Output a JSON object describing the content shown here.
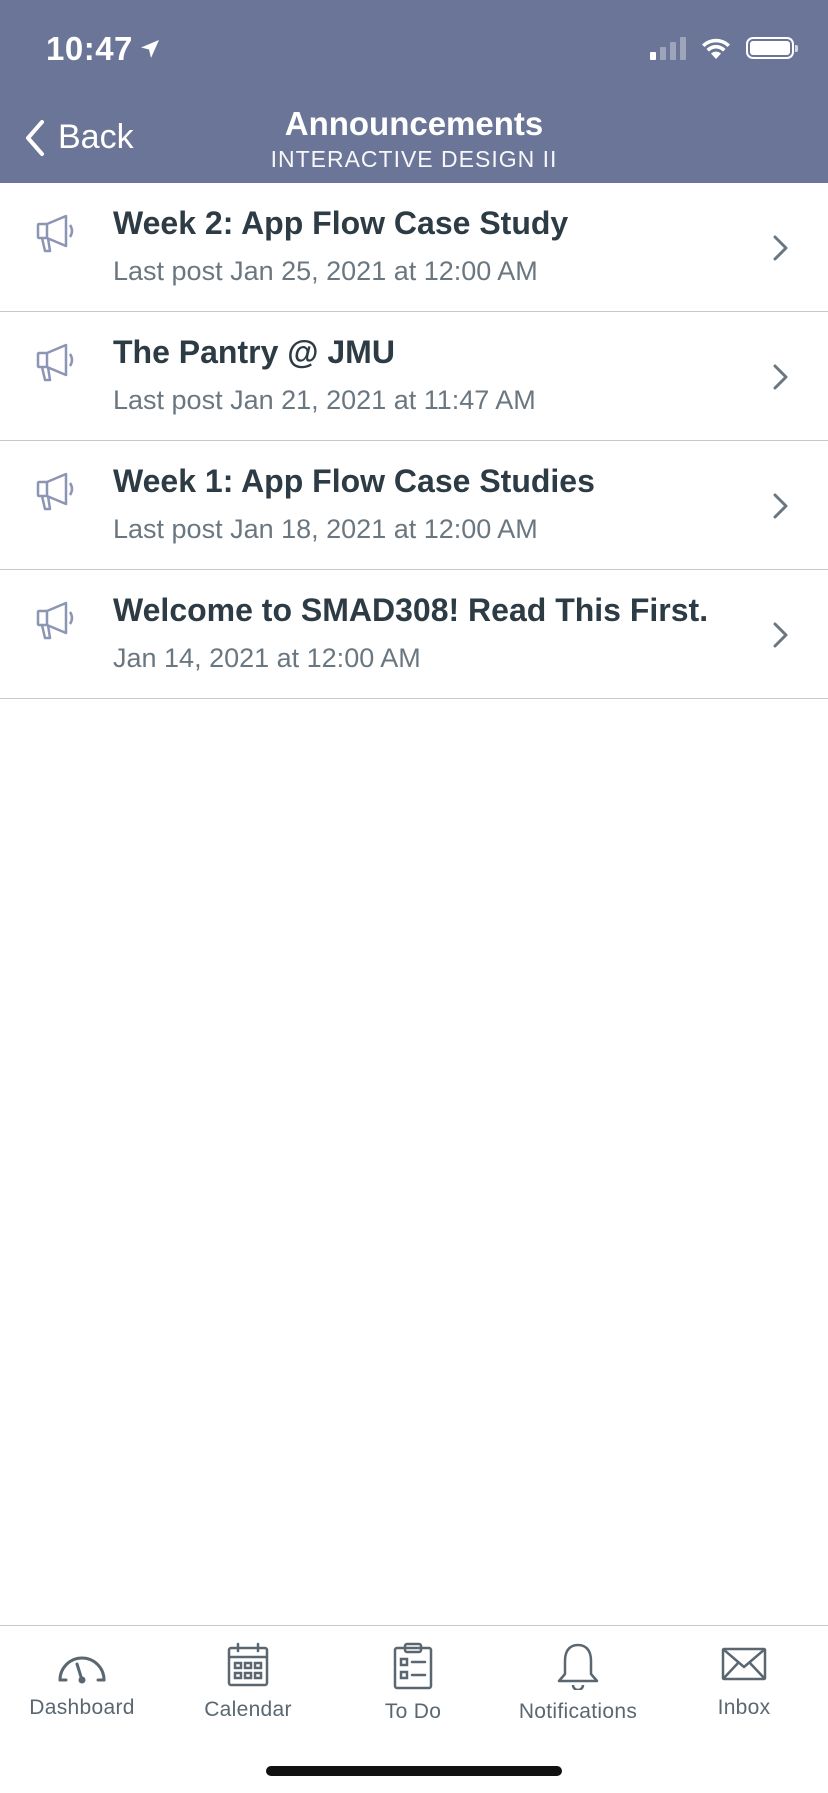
{
  "status_bar": {
    "time": "10:47"
  },
  "header": {
    "back_label": "Back",
    "title": "Announcements",
    "subtitle": "INTERACTIVE DESIGN II"
  },
  "announcements": [
    {
      "title": "Week 2: App Flow Case Study",
      "date": "Last post Jan 25, 2021 at 12:00 AM"
    },
    {
      "title": "The Pantry @ JMU",
      "date": "Last post Jan 21, 2021 at 11:47 AM"
    },
    {
      "title": "Week 1: App Flow Case Studies",
      "date": "Last post Jan 18, 2021 at 12:00 AM"
    },
    {
      "title": "Welcome to SMAD308! Read This First.",
      "date": "Jan 14, 2021 at 12:00 AM"
    }
  ],
  "tab_bar": {
    "items": [
      {
        "label": "Dashboard",
        "icon": "dashboard-icon"
      },
      {
        "label": "Calendar",
        "icon": "calendar-icon"
      },
      {
        "label": "To Do",
        "icon": "todo-icon"
      },
      {
        "label": "Notifications",
        "icon": "bell-icon"
      },
      {
        "label": "Inbox",
        "icon": "inbox-icon"
      }
    ]
  },
  "colors": {
    "header_bg": "#6b7597",
    "title_text": "#2d3b45",
    "secondary_text": "#6b7780",
    "icon": "#8c96b4"
  }
}
